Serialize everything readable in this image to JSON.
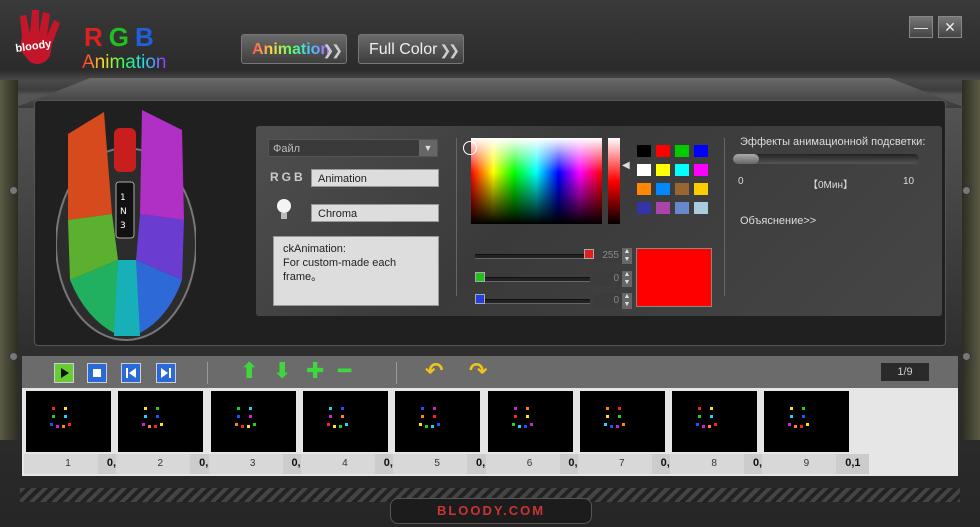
{
  "app": {
    "brand": "bloody",
    "logo_rgb": "RGB",
    "logo_animation": "Animation"
  },
  "tabs": [
    {
      "label": "Animation",
      "active": true
    },
    {
      "label": "Full Color",
      "active": false
    }
  ],
  "window": {
    "minimize": "—",
    "close": "✕"
  },
  "editor": {
    "file_select": "Файл",
    "rgb_label": "RGB",
    "name_field": "Animation",
    "effect_field": "Chroma",
    "description": "ckAnimation:\nFor custom-made each frame。"
  },
  "color": {
    "red_value": "255",
    "green_value": "0",
    "blue_value": "0",
    "preview": "#ff0000",
    "swatch_colors": [
      "#000000",
      "#ff0000",
      "#00cc00",
      "#0000ff",
      "#ffffff",
      "#ffff00",
      "#00ffff",
      "#ff00ff",
      "#ff8800",
      "#0088ff",
      "#996633",
      "#ffcc00",
      "#3333aa",
      "#aa44aa",
      "#6688cc",
      "#aaccdd"
    ]
  },
  "effects": {
    "title": "Эффекты анимационной подсветки:",
    "min_label": "0",
    "max_label": "10",
    "mid_label": "【0Мин】",
    "explain_link": "Объяснение>>"
  },
  "toolbar": {
    "counter": "1/9"
  },
  "frames": [
    {
      "label": "1",
      "delay": "0,1"
    },
    {
      "label": "2",
      "delay": "0,1"
    },
    {
      "label": "3",
      "delay": "0,1"
    },
    {
      "label": "4",
      "delay": "0,1"
    },
    {
      "label": "5",
      "delay": "0,1"
    },
    {
      "label": "6",
      "delay": "0,1"
    },
    {
      "label": "7",
      "delay": "0,1"
    },
    {
      "label": "8",
      "delay": "0,1"
    },
    {
      "label": "9",
      "delay": "0,1"
    }
  ],
  "footer": {
    "site": "BLOODY.COM"
  }
}
